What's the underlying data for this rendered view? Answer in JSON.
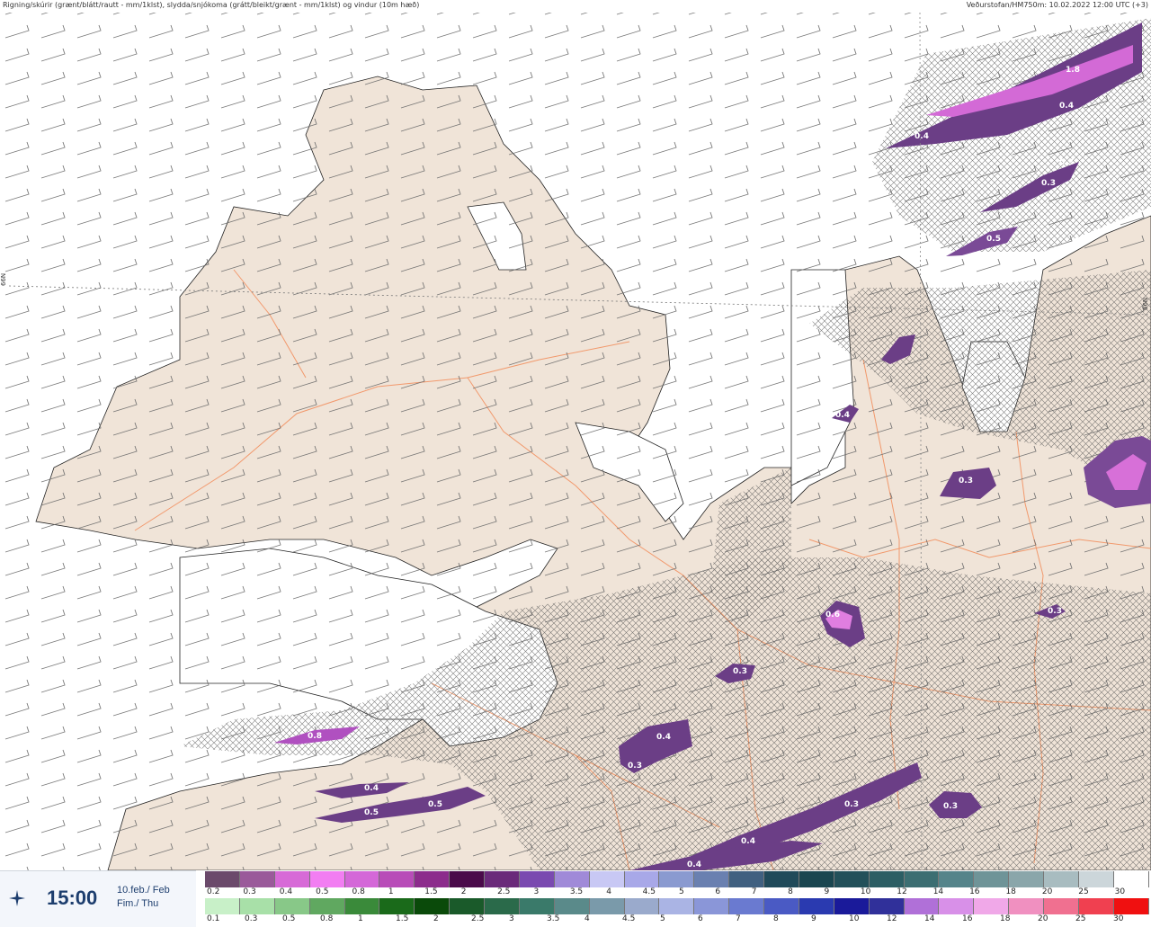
{
  "header": {
    "left": "Rigning/skúrir (grænt/blátt/rautt - mm/1klst), slydda/snjókoma (grátt/bleikt/grænt - mm/1klst) og vindur (10m hæð)",
    "right": "Veðurstofan/HM750m: 10.02.2022 12:00 UTC (+3)"
  },
  "map": {
    "lat_label_left": "66N",
    "lat_label_right": "66N",
    "labels": [
      "1.8",
      "0.4",
      "0.4",
      "0.3",
      "0.3",
      "0.5",
      "0.4",
      "0.3",
      "0.6",
      "0.3",
      "0.3",
      "0.4",
      "0.3",
      "0.8",
      "0.4",
      "0.5",
      "0.5",
      "0.3",
      "0.3",
      "0.4",
      "0.4"
    ]
  },
  "footer": {
    "time": "15:00",
    "date_line1": "10.feb./ Feb",
    "date_line2": "Fim./ Thu",
    "logo_icon": "star-logo-icon"
  },
  "scale_top": {
    "colors": [
      "#6b4a6b",
      "#9a5a9a",
      "#d76ad7",
      "#f27ef2",
      "#d468d8",
      "#b84cb8",
      "#8c2c8c",
      "#4a0a4a",
      "#6a2a7a",
      "#7a4ab0",
      "#a08ad8",
      "#c8c8f4",
      "#a8a8e8",
      "#8a9ad0",
      "#6a80b0",
      "#406080",
      "#204a5a",
      "#1a4650",
      "#23505a",
      "#2c5e64",
      "#3c6e72",
      "#55848a",
      "#6f9498",
      "#8aa6aa",
      "#a8bcc0",
      "#ccd6da",
      "#ffffff"
    ],
    "ticks": [
      "0.2",
      "0.3",
      "0.4",
      "0.5",
      "0.8",
      "1",
      "1.5",
      "2",
      "2.5",
      "3",
      "3.5",
      "4",
      "4.5",
      "5",
      "6",
      "7",
      "8",
      "9",
      "10",
      "12",
      "14",
      "16",
      "18",
      "20",
      "25",
      "30"
    ]
  },
  "scale_bottom": {
    "colors": [
      "#c8f0c8",
      "#a8e0a8",
      "#88c888",
      "#60a860",
      "#3a8a3a",
      "#1a6a1a",
      "#0a4a0a",
      "#1a5a2a",
      "#2a6a4a",
      "#3a7a6a",
      "#5a8a8a",
      "#7a9aaa",
      "#9aaacc",
      "#aab4e4",
      "#8a96d8",
      "#6a7ad0",
      "#4a5ac4",
      "#2a3ab0",
      "#1a1a9a",
      "#30309a",
      "#b070d8",
      "#d890e8",
      "#f0a8e8",
      "#f090c0",
      "#f07090",
      "#f04050",
      "#f01010"
    ],
    "ticks": [
      "0.1",
      "0.3",
      "0.5",
      "0.8",
      "1",
      "1.5",
      "2",
      "2.5",
      "3",
      "3.5",
      "4",
      "4.5",
      "5",
      "6",
      "7",
      "8",
      "9",
      "10",
      "12",
      "14",
      "16",
      "18",
      "20",
      "25",
      "30"
    ]
  }
}
